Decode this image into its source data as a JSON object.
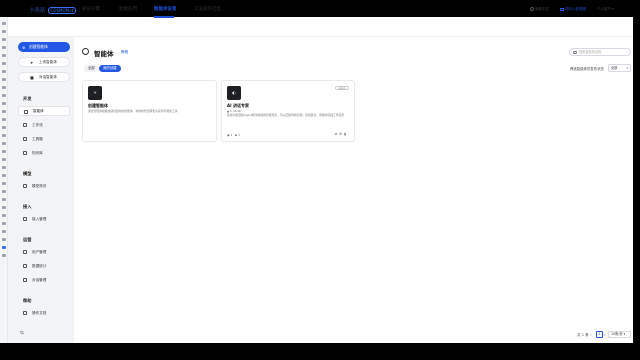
{
  "app": {
    "logo_text": "卡奥斯",
    "logo_mark": "COSMOPlat",
    "accent": "#2357e6"
  },
  "topnav": {
    "items": [
      {
        "label": "知识引擎",
        "active": false
      },
      {
        "label": "智能应用",
        "active": false
      },
      {
        "label": "智能体设者",
        "active": true
      },
      {
        "label": "工业知识社区",
        "active": false
      }
    ],
    "lang_label": "简体中文",
    "access_link": "访问入驻说明",
    "user_label": "个人用户"
  },
  "sidebar": {
    "create_button": "创建智能体",
    "upload_button": "上传智能体",
    "chat_button": "对话智能体",
    "sections": [
      {
        "title": "开发",
        "items": [
          "智能体",
          "工作流",
          "工具箱",
          "知识库"
        ]
      },
      {
        "title": "模型",
        "items": [
          "模型测评"
        ]
      },
      {
        "title": "接入",
        "items": [
          "接入管理"
        ]
      },
      {
        "title": "运营",
        "items": [
          "用户管理",
          "数据统计",
          "对话管理"
        ]
      },
      {
        "title": "帮助",
        "items": [
          "操作文档"
        ]
      }
    ],
    "active_item": "智能体",
    "collapse_icon": "collapse-icon"
  },
  "main": {
    "title": "智能体",
    "guide_link": "教程",
    "search_placeholder": "搜索智能体名称",
    "tabs": [
      {
        "label": "全部",
        "active": false
      },
      {
        "label": "我的创建",
        "active": true
      }
    ],
    "filter_label": "筛选智能体的发布状态",
    "filter_value": "全部"
  },
  "cards": [
    {
      "type": "create",
      "icon": "plus-icon",
      "title": "创建智能体",
      "desc": "通过智能体模板快速创建你的智能体，将你的想法转化为实际可用的工具"
    },
    {
      "type": "agent",
      "icon": "agent-logo-icon",
      "title": "AI 讲话专家",
      "badge": "未发布",
      "meta": "▲ 1 / 6.1K",
      "desc": "使用大模型和Agent框架构建的智能专家，可以回答你的问题，提供建议，帮助你完成工作任务",
      "stats": [
        "1",
        "1"
      ],
      "actions": [
        "copy-icon",
        "settings-icon",
        "delete-icon"
      ]
    }
  ],
  "pagination": {
    "total": "共 1 条",
    "current": "1",
    "page_size": "10条/页"
  }
}
